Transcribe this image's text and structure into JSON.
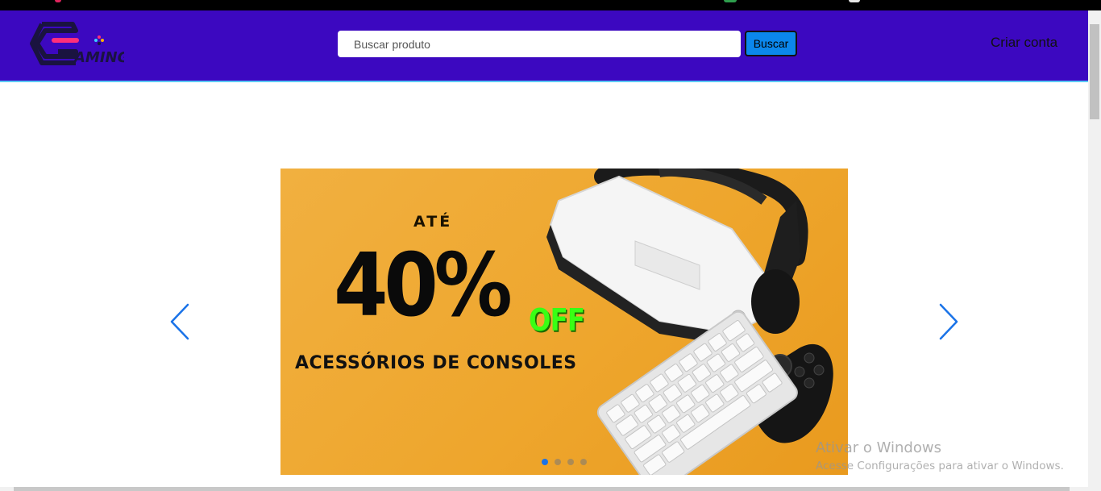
{
  "header": {
    "logo_text": "AMING",
    "search": {
      "placeholder": "Buscar produto",
      "value": ""
    },
    "search_button_label": "Buscar",
    "account_link_label": "Criar conta"
  },
  "carousel": {
    "active_index": 0,
    "slide_count": 4,
    "slide": {
      "prefix": "ATÉ",
      "discount": "40%",
      "off_label": "OFF",
      "subtitle": "ACESSÓRIOS DE CONSOLES"
    },
    "prev_icon": "chevron-left-icon",
    "next_icon": "chevron-right-icon"
  },
  "os_watermark": {
    "title": "Ativar o Windows",
    "subtitle": "Acesse Configurações para ativar o Windows."
  },
  "colors": {
    "header_bg": "#3c08c0",
    "header_border": "#59c8f5",
    "search_button_bg": "#0b87ec",
    "banner_bg": "#eea62d",
    "off_green": "#39ff14",
    "carousel_arrow": "#1a73e8",
    "logo_pink": "#ff2f7a",
    "logo_navy": "#1a1340"
  }
}
